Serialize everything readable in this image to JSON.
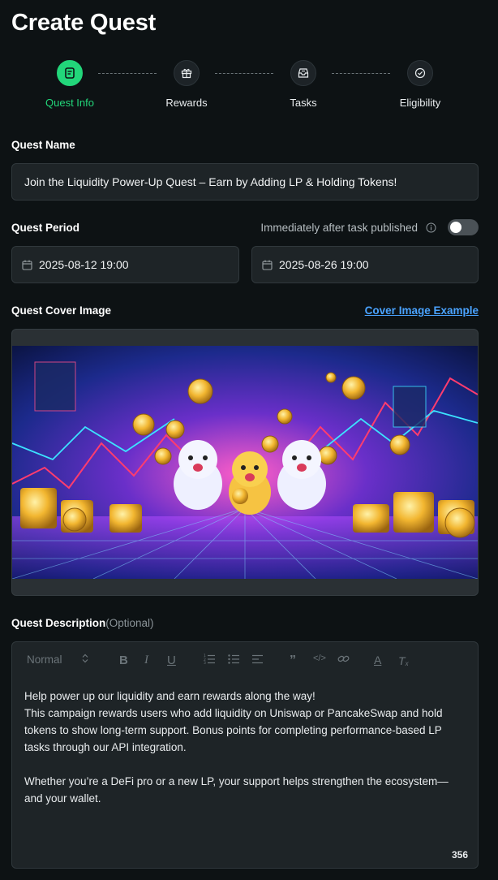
{
  "page": {
    "title": "Create Quest"
  },
  "stepper": {
    "steps": [
      {
        "label": "Quest Info",
        "icon": "document-icon",
        "active": true
      },
      {
        "label": "Rewards",
        "icon": "gift-icon",
        "active": false
      },
      {
        "label": "Tasks",
        "icon": "inbox-icon",
        "active": false
      },
      {
        "label": "Eligibility",
        "icon": "check-badge-icon",
        "active": false
      }
    ]
  },
  "quest_name": {
    "label": "Quest Name",
    "value": "Join the Liquidity Power-Up Quest – Earn by Adding LP & Holding Tokens!"
  },
  "quest_period": {
    "label": "Quest Period",
    "toggle_label": "Immediately after task published",
    "toggle_on": false,
    "start": "2025-08-12 19:00",
    "end": "2025-08-26 19:00"
  },
  "cover_image": {
    "label": "Quest Cover Image",
    "example_link": "Cover Image Example"
  },
  "description": {
    "label": "Quest Description",
    "optional": "(Optional)",
    "format_select": "Normal",
    "paragraphs": [
      "Help power up our liquidity and earn rewards along the way!",
      "This campaign rewards users who add liquidity on Uniswap or PancakeSwap and hold tokens to show long-term support. Bonus points for completing performance-based LP tasks through our API integration.",
      "Whether you’re a DeFi pro or a new LP, your support helps strengthen the ecosystem—and your wallet."
    ],
    "char_count": "356"
  },
  "colors": {
    "accent": "#22d67a",
    "link": "#4aa3ff",
    "background": "#0d1214"
  }
}
